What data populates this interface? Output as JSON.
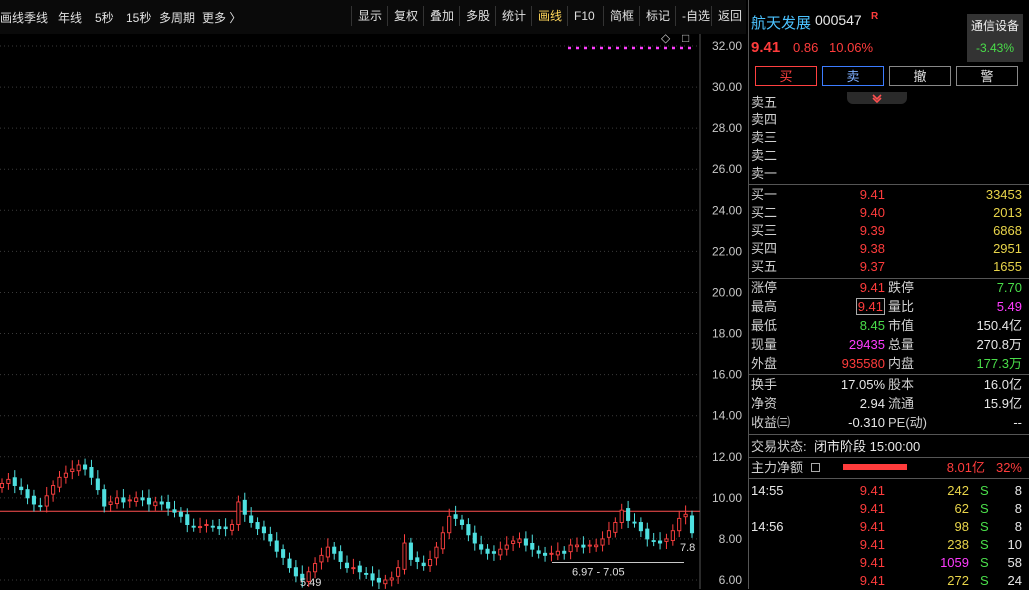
{
  "toolbar": {
    "timeframes": [
      "画线",
      "季线",
      "年线",
      "5秒",
      "15秒",
      "多周期",
      "更多 〉"
    ],
    "tools": [
      "显示",
      "复权",
      "叠加",
      "多股",
      "统计",
      "画线",
      "F10",
      "简框",
      "标记",
      "-自选",
      "返回"
    ],
    "active_tool": "画线"
  },
  "chart": {
    "y_ticks": [
      "32.00",
      "30.00",
      "28.00",
      "26.00",
      "24.00",
      "22.00",
      "20.00",
      "18.00",
      "16.00",
      "14.00",
      "12.00",
      "10.00",
      "8.00",
      "6.00"
    ],
    "range_label": "6.97 - 7.05",
    "last_label": "7.8",
    "low_label": "5.49",
    "controls": [
      "◇",
      "□"
    ]
  },
  "chart_data": {
    "type": "candlestick",
    "ylim": [
      6.0,
      32.0
    ],
    "reference_line": 9.35,
    "close_approx": [
      10.7,
      10.9,
      10.6,
      10.4,
      10.0,
      9.7,
      9.6,
      10.1,
      10.6,
      11.0,
      11.2,
      11.4,
      11.6,
      11.4,
      11.0,
      10.4,
      9.6,
      9.8,
      10.0,
      9.8,
      9.9,
      10.0,
      9.9,
      9.7,
      9.8,
      9.7,
      9.5,
      9.3,
      9.1,
      8.7,
      8.6,
      8.6,
      8.7,
      8.6,
      8.5,
      8.5,
      8.7,
      9.8,
      9.2,
      8.8,
      8.5,
      8.3,
      7.9,
      7.4,
      7.1,
      6.6,
      6.2,
      6.0,
      6.4,
      6.8,
      7.2,
      7.6,
      7.3,
      6.9,
      6.6,
      6.6,
      6.4,
      6.3,
      6.0,
      5.9,
      6.0,
      6.1,
      6.6,
      7.8,
      7.0,
      6.9,
      6.7,
      7.0,
      7.6,
      8.3,
      9.1,
      9.0,
      8.7,
      8.2,
      7.8,
      7.5,
      7.3,
      7.3,
      7.5,
      7.7,
      7.9,
      8.0,
      7.7,
      7.5,
      7.3,
      7.2,
      7.3,
      7.4,
      7.3,
      7.7,
      7.7,
      7.6,
      7.7,
      7.7,
      8.0,
      8.4,
      8.8,
      9.4,
      8.9,
      8.8,
      8.4,
      8.0,
      7.9,
      7.8,
      8.0,
      8.4,
      9.0,
      9.2,
      8.3
    ]
  },
  "quote": {
    "name": "航天发展",
    "code": "000547",
    "r_mark": "R",
    "sector": "通信设备",
    "sector_pct": "-3.43%",
    "price": "9.41",
    "change": "0.86",
    "change_pct": "10.06%"
  },
  "trade_buttons": [
    "买",
    "卖",
    "撤",
    "警"
  ],
  "collapse_icon": "chevron-down-icon",
  "asks": [
    {
      "label": "卖五",
      "price": "",
      "vol": ""
    },
    {
      "label": "卖四",
      "price": "",
      "vol": ""
    },
    {
      "label": "卖三",
      "price": "",
      "vol": ""
    },
    {
      "label": "卖二",
      "price": "",
      "vol": ""
    },
    {
      "label": "卖一",
      "price": "",
      "vol": ""
    }
  ],
  "bids": [
    {
      "label": "买一",
      "price": "9.41",
      "vol": "33453"
    },
    {
      "label": "买二",
      "price": "9.40",
      "vol": "2013"
    },
    {
      "label": "买三",
      "price": "9.39",
      "vol": "6868"
    },
    {
      "label": "买四",
      "price": "9.38",
      "vol": "2951"
    },
    {
      "label": "买五",
      "price": "9.37",
      "vol": "1655"
    }
  ],
  "stats": [
    {
      "l1": "涨停",
      "v1": "9.41",
      "c1": "red",
      "l2": "跌停",
      "v2": "7.70",
      "c2": "green"
    },
    {
      "l1": "最高",
      "v1": "9.41",
      "c1": "red",
      "l2": "量比",
      "v2": "5.49",
      "c2": "magenta"
    },
    {
      "l1": "最低",
      "v1": "8.45",
      "c1": "green",
      "l2": "市值",
      "v2": "150.4亿",
      "c2": "white"
    },
    {
      "l1": "现量",
      "v1": "29435",
      "c1": "magenta",
      "l2": "总量",
      "v2": "270.8万",
      "c2": "white"
    },
    {
      "l1": "外盘",
      "v1": "935580",
      "c1": "red",
      "l2": "内盘",
      "v2": "177.3万",
      "c2": "green"
    }
  ],
  "fundamentals": [
    {
      "l1": "换手",
      "v1": "17.05%",
      "l2": "股本",
      "v2": "16.0亿"
    },
    {
      "l1": "净资",
      "v1": "2.94",
      "l2": "流通",
      "v2": "15.9亿"
    },
    {
      "l1": "收益㈢",
      "v1": "-0.310",
      "l2": "PE(动)",
      "v2": "--"
    }
  ],
  "status": {
    "label": "交易状态:",
    "value": "闭市阶段 15:00:00"
  },
  "mainflow": {
    "label": "主力净额",
    "value": "8.01亿",
    "pct": "32%"
  },
  "ticks": [
    {
      "time": "14:55",
      "price": "9.41",
      "vol": "242",
      "vc": "yellow",
      "side": "S",
      "n": "8"
    },
    {
      "time": "",
      "price": "9.41",
      "vol": "62",
      "vc": "yellow",
      "side": "S",
      "n": "8"
    },
    {
      "time": "14:56",
      "price": "9.41",
      "vol": "98",
      "vc": "yellow",
      "side": "S",
      "n": "8"
    },
    {
      "time": "",
      "price": "9.41",
      "vol": "238",
      "vc": "yellow",
      "side": "S",
      "n": "10"
    },
    {
      "time": "",
      "price": "9.41",
      "vol": "1059",
      "vc": "magenta",
      "side": "S",
      "n": "58"
    },
    {
      "time": "",
      "price": "9.41",
      "vol": "272",
      "vc": "yellow",
      "side": "S",
      "n": "24"
    }
  ]
}
